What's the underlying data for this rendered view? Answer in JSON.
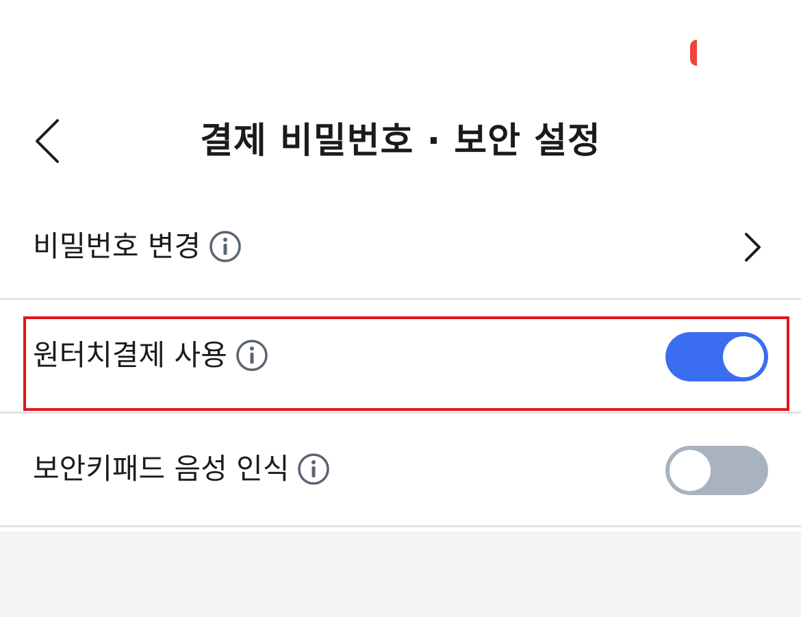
{
  "header": {
    "title": "결제 비밀번호 · 보안 설정",
    "back_icon": "chevron-left-icon"
  },
  "settings": {
    "change_password": {
      "label": "비밀번호 변경",
      "info_icon": "info-icon",
      "nav_icon": "chevron-right-icon"
    },
    "one_touch_payment": {
      "label": "원터치결제 사용",
      "info_icon": "info-icon",
      "enabled": true
    },
    "keypad_voice": {
      "label": "보안키패드 음성 인식",
      "info_icon": "info-icon",
      "enabled": false
    }
  },
  "colors": {
    "toggle_on": "#3a6df0",
    "toggle_off": "#a9b3bf",
    "highlight": "#e5141b",
    "status_indicator": "#f0443a"
  }
}
